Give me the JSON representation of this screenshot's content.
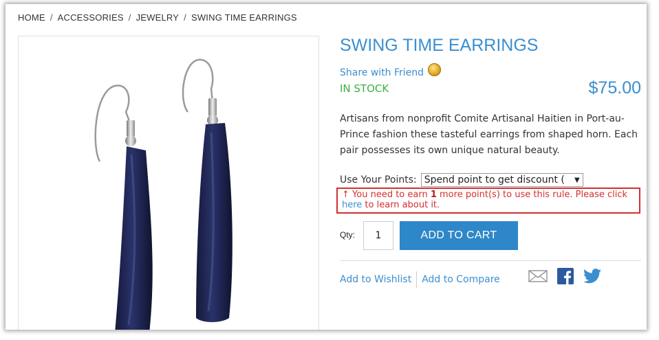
{
  "breadcrumb": {
    "items": [
      "HOME",
      "ACCESSORIES",
      "JEWELRY",
      "SWING TIME EARRINGS"
    ],
    "separator": "/"
  },
  "product": {
    "title": "SWING TIME EARRINGS",
    "share_label": "Share with Friend",
    "stock": "IN STOCK",
    "price": "$75.00",
    "description": "Artisans from nonprofit Comite Artisanal Haitien in Port-au-Prince fashion these tasteful earrings from shaped horn. Each pair possesses its own unique natural beauty."
  },
  "points": {
    "label": "Use Your Points:",
    "selected": "Spend point to get discount (",
    "warning_prefix": "You need to earn ",
    "warning_count": "1",
    "warning_middle": " more point(s) to use this rule. Please click ",
    "warning_link": "here",
    "warning_suffix": " to learn about it."
  },
  "cart": {
    "qty_label": "Qty:",
    "qty_value": "1",
    "button_label": "ADD TO CART"
  },
  "actions": {
    "wishlist": "Add to Wishlist",
    "compare": "Add to Compare"
  },
  "colors": {
    "accent": "#3a8fd0",
    "stock": "#3cb043",
    "warning": "#d32f2f",
    "button": "#2e87c8",
    "earring": "#1e2450"
  },
  "icons": [
    "coin-icon",
    "mail-icon",
    "facebook-icon",
    "twitter-icon"
  ]
}
